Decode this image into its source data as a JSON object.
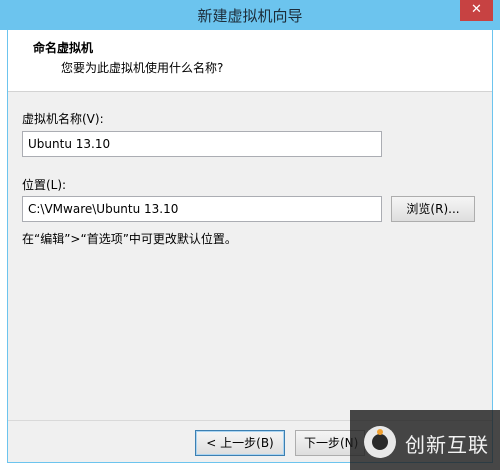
{
  "window": {
    "title": "新建虚拟机向导",
    "close_label": "✕"
  },
  "header": {
    "title": "命名虚拟机",
    "subtitle": "您要为此虚拟机使用什么名称?"
  },
  "form": {
    "name_label": "虚拟机名称(V):",
    "name_value": "Ubuntu 13.10",
    "location_label": "位置(L):",
    "location_value": "C:\\VMware\\Ubuntu 13.10",
    "browse_label": "浏览(R)...",
    "hint": "在“编辑”>“首选项”中可更改默认位置。"
  },
  "footer": {
    "back_label": "< 上一步(B)",
    "next_label": "下一步(N)"
  },
  "watermark": {
    "text": "创新互联"
  }
}
